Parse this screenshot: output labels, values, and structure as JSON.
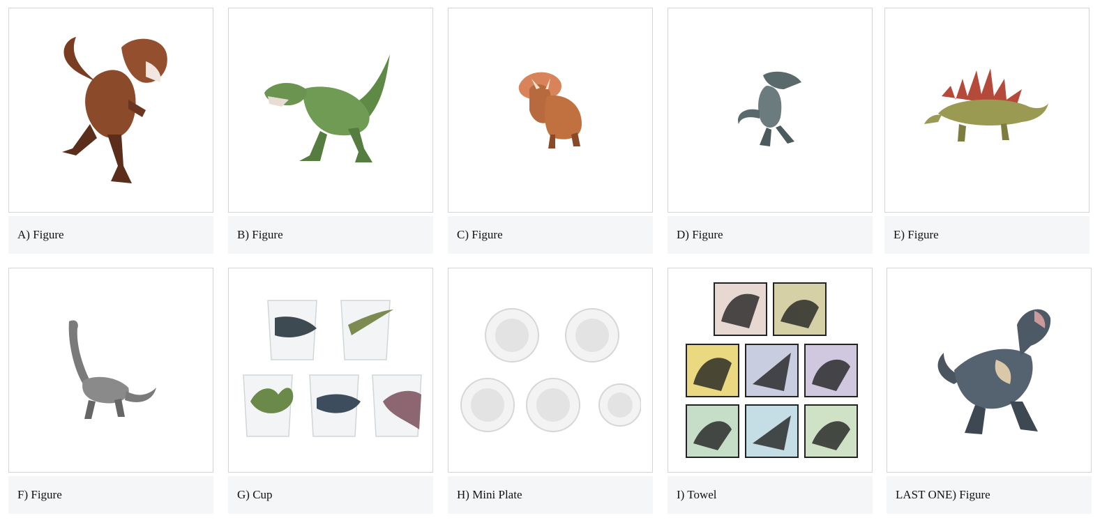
{
  "prizes": [
    {
      "label": "A) Figure",
      "image": "red-tyrannosaurus-figure"
    },
    {
      "label": "B) Figure",
      "image": "green-tyrannosaurus-figure"
    },
    {
      "label": "C) Figure",
      "image": "triceratops-figure"
    },
    {
      "label": "D) Figure",
      "image": "velociraptor-figure"
    },
    {
      "label": "E) Figure",
      "image": "stegosaurus-figure"
    },
    {
      "label": "F) Figure",
      "image": "brachiosaurus-figure"
    },
    {
      "label": "G) Cup",
      "image": "prehistoric-cups-set"
    },
    {
      "label": "H) Mini Plate",
      "image": "fossil-mini-plates-set"
    },
    {
      "label": "I) Towel",
      "image": "ink-dinosaur-towels-set"
    },
    {
      "label": "LAST ONE) Figure",
      "image": "dark-tyrannosaurus-figure"
    }
  ],
  "colors": {
    "caption_bg": "#f5f6f8",
    "border": "#d4d4d4"
  }
}
